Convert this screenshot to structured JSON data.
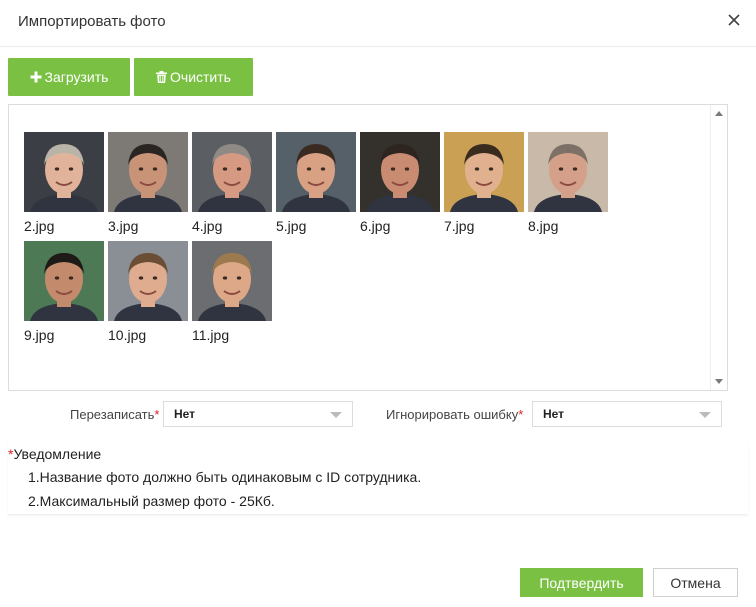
{
  "dialog": {
    "title": "Импортировать фото"
  },
  "toolbar": {
    "upload_label": "Загрузить",
    "clear_label": "Очистить"
  },
  "photos": [
    {
      "name": "2.jpg",
      "skin": "#e0b39a",
      "hair": "#b9b4a8",
      "bg": "#3b3f45"
    },
    {
      "name": "3.jpg",
      "skin": "#c99378",
      "hair": "#2a2522",
      "bg": "#7d7a75"
    },
    {
      "name": "4.jpg",
      "skin": "#d69a83",
      "hair": "#8f8a86",
      "bg": "#5b5e63"
    },
    {
      "name": "5.jpg",
      "skin": "#d8a183",
      "hair": "#3b2a22",
      "bg": "#566068"
    },
    {
      "name": "6.jpg",
      "skin": "#c98c72",
      "hair": "#2e2520",
      "bg": "#34302c"
    },
    {
      "name": "7.jpg",
      "skin": "#e1b18f",
      "hair": "#3a2b1f",
      "bg": "#c9a054"
    },
    {
      "name": "8.jpg",
      "skin": "#d4a08a",
      "hair": "#7d7066",
      "bg": "#c9b9a9"
    },
    {
      "name": "9.jpg",
      "skin": "#c48a6c",
      "hair": "#1e1a18",
      "bg": "#4d7a54"
    },
    {
      "name": "10.jpg",
      "skin": "#dfac8f",
      "hair": "#6a4e35",
      "bg": "#8a8f95"
    },
    {
      "name": "11.jpg",
      "skin": "#dca888",
      "hair": "#9c7a4e",
      "bg": "#6b6d70"
    }
  ],
  "options": {
    "overwrite_label": "Перезаписать",
    "overwrite_value": "Нет",
    "ignore_error_label": "Игнорировать ошибку",
    "ignore_error_value": "Нет",
    "required_mark": "*"
  },
  "notice": {
    "title": "Уведомление",
    "line1": "1.Название фото должно быть одинаковым с ID сотрудника.",
    "line2": "2.Максимальный размер фото - 25Кб."
  },
  "footer": {
    "confirm_label": "Подтвердить",
    "cancel_label": "Отмена"
  },
  "colors": {
    "accent": "#7ac143",
    "required": "#e02020"
  }
}
